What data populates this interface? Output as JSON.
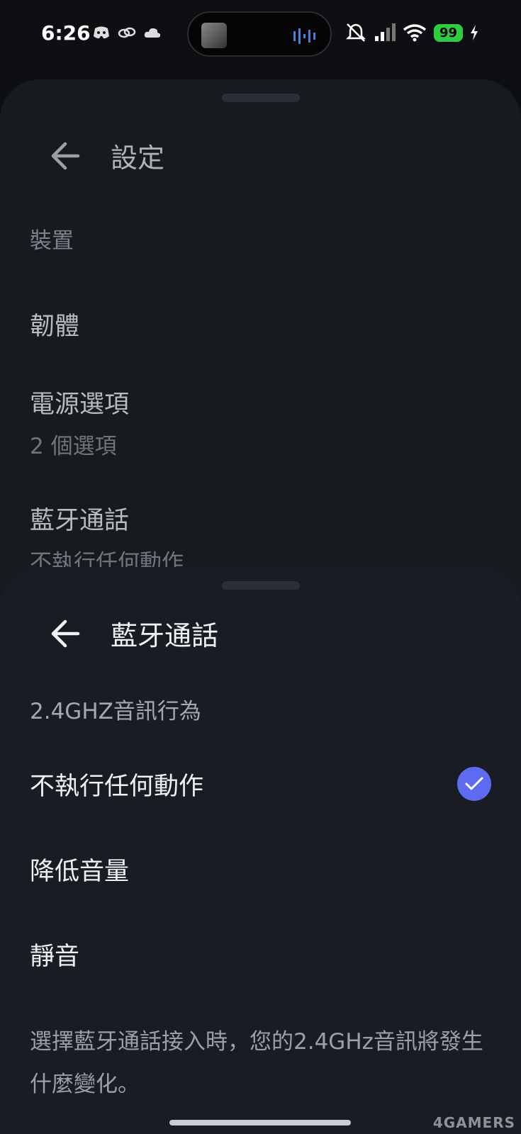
{
  "status": {
    "time": "6:26",
    "battery": "99",
    "icons_left": [
      "discord-icon",
      "link-icon",
      "cloud-icon"
    ],
    "icons_right": [
      "mute-bell-icon",
      "signal-icon",
      "wifi-icon",
      "charging-icon"
    ]
  },
  "back_sheet": {
    "title": "設定",
    "section": "裝置",
    "items": [
      {
        "title": "韌體"
      },
      {
        "title": "電源選項",
        "subtitle": "2 個選項"
      },
      {
        "title": "藍牙通話",
        "subtitle": "不執行任何動作"
      }
    ]
  },
  "front_sheet": {
    "title": "藍牙通話",
    "section": "2.4GHZ音訊行為",
    "options": [
      {
        "label": "不執行任何動作",
        "selected": true
      },
      {
        "label": "降低音量",
        "selected": false
      },
      {
        "label": "靜音",
        "selected": false
      }
    ],
    "description": "選擇藍牙通話接入時，您的2.4GHz音訊將發生什麼變化。"
  },
  "watermark": "4GAMERS",
  "colors": {
    "accent": "#5d6bf0",
    "battery": "#2ecc40"
  }
}
